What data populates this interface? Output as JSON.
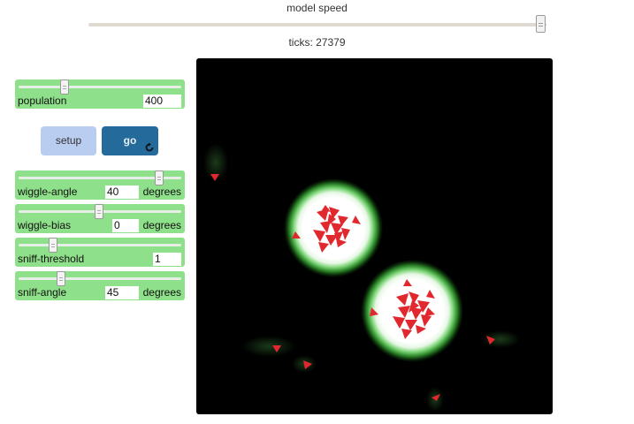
{
  "speed": {
    "label": "model speed"
  },
  "ticks_text": "ticks: 27379",
  "buttons": {
    "setup": "setup",
    "go": "go"
  },
  "sliders": {
    "population": {
      "label": "population",
      "value": "400",
      "units": ""
    },
    "wiggle_angle": {
      "label": "wiggle-angle",
      "value": "40",
      "units": "degrees"
    },
    "wiggle_bias": {
      "label": "wiggle-bias",
      "value": "0",
      "units": "degrees"
    },
    "sniff_threshold": {
      "label": "sniff-threshold",
      "value": "1",
      "units": ""
    },
    "sniff_angle": {
      "label": "sniff-angle",
      "value": "45",
      "units": "degrees"
    }
  },
  "colors": {
    "widget_bg": "#8fe08a",
    "setup_button": "#b9cdf0",
    "go_button": "#246a9a",
    "world_bg": "#000000",
    "agent": "#e0282e",
    "pheromone_center": "#ffffff",
    "pheromone_glow": "#3fb33a"
  },
  "icons": {
    "forever": "forever-icon"
  }
}
